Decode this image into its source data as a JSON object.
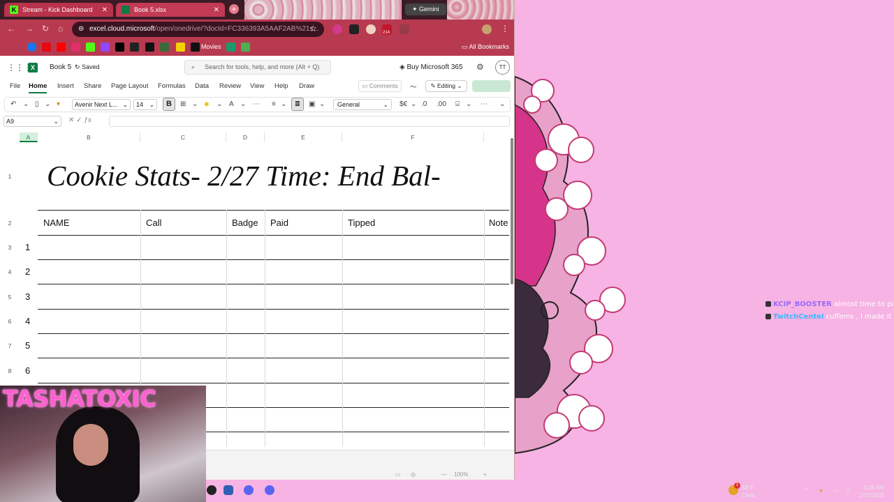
{
  "browser": {
    "tabs": [
      {
        "label": "Stream - Kick Dashboard",
        "color": "#53fc18"
      },
      {
        "label": "Book 5.xlsx",
        "color": "#107c41"
      }
    ],
    "gemini_label": "Gemini",
    "address": "excel.cloud.microsoft",
    "address_rest": "/open/onedrive/?docId=FC336393A5AAF2AB%21s...",
    "ext_badge": "214",
    "bookmarks": {
      "movies_label": "Movies",
      "all_label": "All Bookmarks"
    }
  },
  "excel": {
    "doc_name": "Book 5",
    "saved_label": "Saved",
    "search_placeholder": "Search for tools, help, and more (Alt + Q)",
    "buy_label": "Buy Microsoft 365",
    "avatar_initials": "TT",
    "menu": [
      "File",
      "Home",
      "Insert",
      "Share",
      "Page Layout",
      "Formulas",
      "Data",
      "Review",
      "View",
      "Help",
      "Draw"
    ],
    "comments_label": "Comments",
    "editing_label": "Editing",
    "ribbon": {
      "font": "Avenir Next L...",
      "size": "14",
      "bold": "B",
      "number_format": "General"
    },
    "name_box": "A9",
    "columns": [
      "A",
      "B",
      "C",
      "D",
      "E",
      "F"
    ],
    "rows": [
      "1",
      "2",
      "3",
      "4",
      "5",
      "6",
      "7",
      "8"
    ],
    "title_cell": "Cookie Stats- 2/27 Time: End Bal-",
    "headers": [
      "NAME",
      "Call",
      "Badge",
      "Paid",
      "Tipped",
      "Note"
    ],
    "row_numbers": [
      "1",
      "2",
      "3",
      "4",
      "5",
      "6"
    ],
    "zoom": "100%"
  },
  "overlay": {
    "streamer_name": "TASHATOXIC",
    "chat": [
      {
        "user": "KCIP_BOOSTER",
        "message": "almost time to pin me"
      },
      {
        "user": "TwitchCentel",
        "message": "cuffems , I made it"
      }
    ]
  },
  "taskbar": {
    "weather": "58°F",
    "weather_desc": "Clear",
    "time": "3:18 AM",
    "date": "2/27/2026",
    "notif_count": "1"
  }
}
